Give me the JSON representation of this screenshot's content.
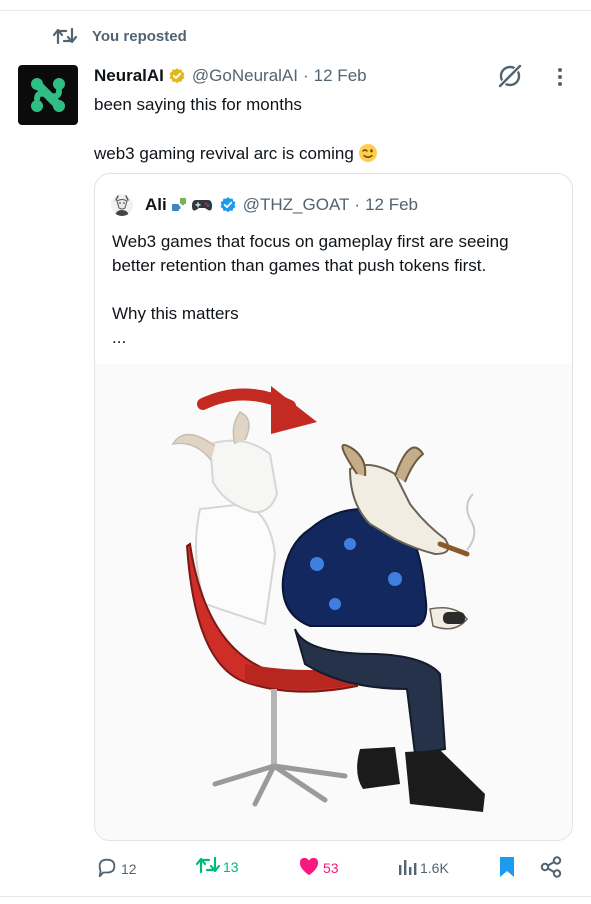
{
  "repost": {
    "label": "You reposted"
  },
  "post": {
    "author_name": "NeuralAI",
    "author_handle": "@GoNeuralAI",
    "separator": "·",
    "date": "12 Feb",
    "text_line1": "been saying this for months",
    "text_line2": "web3 gaming revival arc is coming"
  },
  "quote": {
    "author_name": "Ali",
    "author_handle": "@THZ_GOAT",
    "separator": "·",
    "date": "12 Feb",
    "text_line1": "Web3 games that focus on gameplay first are seeing",
    "text_line2": "better retention than games that push tokens first.",
    "text_line3": "Why this matters",
    "text_line4": "..."
  },
  "actions": {
    "replies": "12",
    "reposts": "13",
    "likes": "53",
    "views": "1.6K"
  },
  "colors": {
    "text": "#0f1419",
    "muted": "#536471",
    "verified_gold": "#e2b719",
    "verified_blue": "#1d9bf0",
    "repost_green": "#00ba7c",
    "like_pink": "#f91880",
    "bookmark_blue": "#1d9bf0"
  },
  "icons": [
    "repost-icon",
    "gold-verified-icon",
    "grok-icon",
    "more-icon",
    "wink-emoji",
    "puzzle-emoji",
    "gamepad-emoji",
    "blue-verified-icon",
    "reply-icon",
    "like-icon",
    "views-icon",
    "bookmark-icon",
    "share-icon"
  ]
}
